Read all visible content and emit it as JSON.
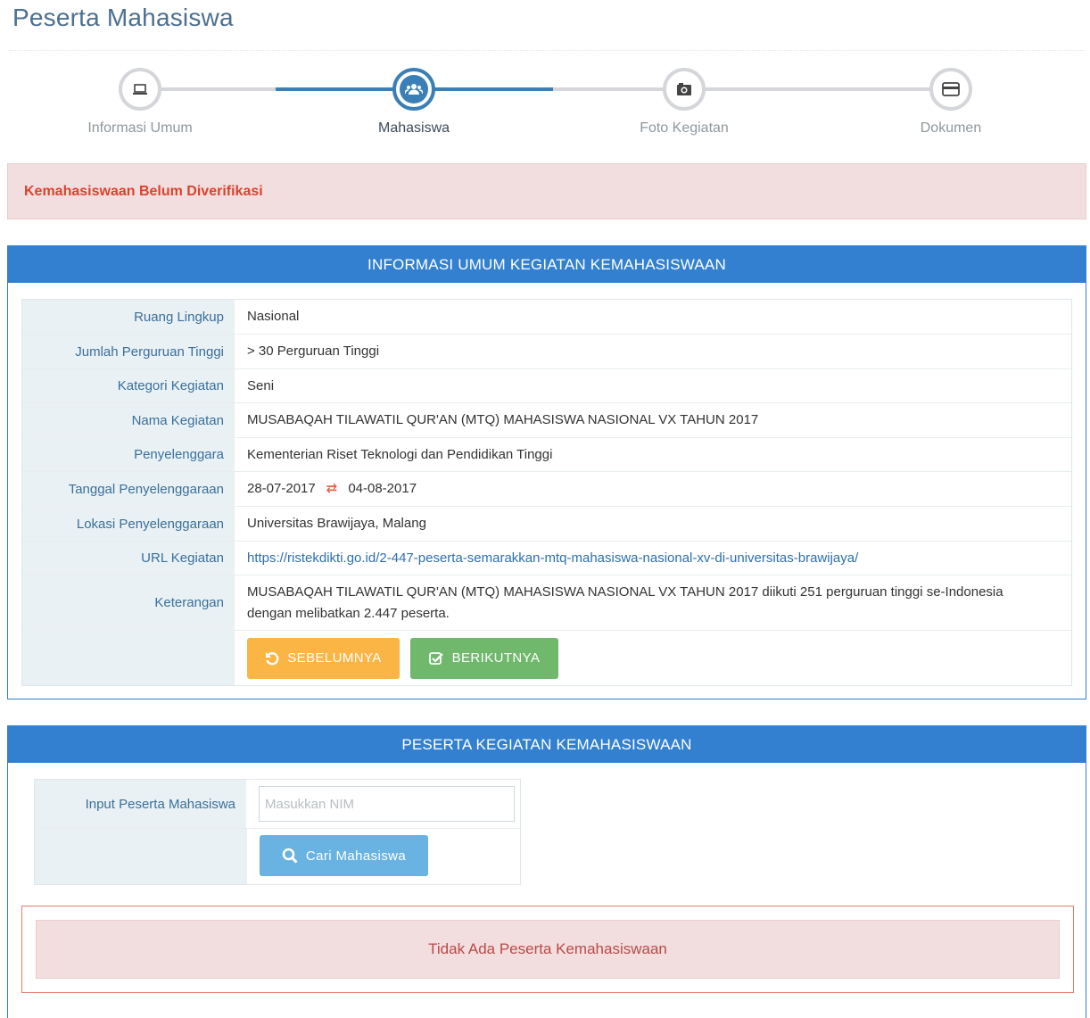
{
  "page": {
    "title": "Peserta Mahasiswa"
  },
  "wizard": {
    "steps": [
      {
        "label": "Informasi Umum",
        "icon": "laptop-icon",
        "active": false
      },
      {
        "label": "Mahasiswa",
        "icon": "users-icon",
        "active": true
      },
      {
        "label": "Foto Kegiatan",
        "icon": "camera-icon",
        "active": false
      },
      {
        "label": "Dokumen",
        "icon": "credit-card-icon",
        "active": false
      }
    ]
  },
  "alert": {
    "text": "Kemahasiswaan Belum Diverifikasi"
  },
  "info_panel": {
    "title": "INFORMASI UMUM KEGIATAN KEMAHASISWAAN",
    "rows": [
      {
        "label": "Ruang Lingkup",
        "value": "Nasional"
      },
      {
        "label": "Jumlah Perguruan Tinggi",
        "value": "> 30 Perguruan Tinggi"
      },
      {
        "label": "Kategori Kegiatan",
        "value": "Seni"
      },
      {
        "label": "Nama Kegiatan",
        "value": "MUSABAQAH TILAWATIL QUR'AN (MTQ) MAHASISWA NASIONAL VX TAHUN 2017"
      },
      {
        "label": "Penyelenggara",
        "value": "Kementerian Riset Teknologi dan Pendidikan Tinggi"
      },
      {
        "label": "Tanggal Penyelenggaraan",
        "start": "28-07-2017",
        "end": "04-08-2017"
      },
      {
        "label": "Lokasi Penyelenggaraan",
        "value": "Universitas Brawijaya, Malang"
      },
      {
        "label": "URL Kegiatan",
        "value": "https://ristekdikti.go.id/2-447-peserta-semarakkan-mtq-mahasiswa-nasional-xv-di-universitas-brawijaya/"
      },
      {
        "label": "Keterangan",
        "value": "MUSABAQAH TILAWATIL QUR'AN (MTQ) MAHASISWA NASIONAL VX TAHUN 2017 diikuti 251 perguruan tinggi se-Indonesia dengan melibatkan 2.447 peserta."
      }
    ],
    "prev_label": "SEBELUMNYA",
    "next_label": "BERIKUTNYA"
  },
  "participants_panel": {
    "title": "PESERTA KEGIATAN KEMAHASISWAAN",
    "input_label": "Input Peserta Mahasiswa",
    "nim_placeholder": "Masukkan NIM",
    "nim_value": "",
    "search_label": "Cari Mahasiswa",
    "empty_text": "Tidak Ada Peserta Kemahasiswaan"
  },
  "colors": {
    "primary": "#3280cf",
    "warning": "#fbb545",
    "success": "#6fb86c",
    "info": "#68b3e2",
    "danger_text": "#d9432f",
    "danger_bg": "#f2dede"
  }
}
